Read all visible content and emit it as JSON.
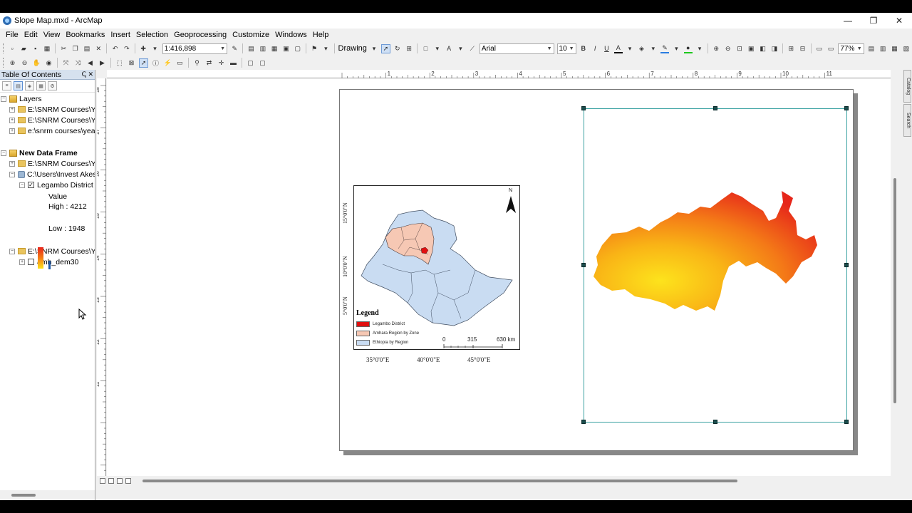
{
  "window": {
    "title": "Slope Map.mxd - ArcMap",
    "controls": [
      "—",
      "❐",
      "✕"
    ]
  },
  "menu": [
    "File",
    "Edit",
    "View",
    "Bookmarks",
    "Insert",
    "Selection",
    "Geoprocessing",
    "Customize",
    "Windows",
    "Help"
  ],
  "toolbar": {
    "scale": "1:416,898",
    "drawing_label": "Drawing",
    "font_name": "Arial",
    "font_size": "10",
    "bold": "B",
    "italic": "I",
    "underline": "U",
    "text_tool": "A",
    "zoom_percent": "77%"
  },
  "toc": {
    "title": "Table Of Contents",
    "header_buttons": "ↅ ✕",
    "layers_group": "Layers",
    "layers_items": [
      "E:\\SNRM Courses\\Yea",
      "E:\\SNRM Courses\\Yea",
      "e:\\snrm courses\\year"
    ],
    "data_frame": "New Data Frame",
    "df_item_1": "E:\\SNRM Courses\\Yea",
    "df_item_2": "C:\\Users\\Invest Akest",
    "layer_name": "Legambo District",
    "value_label": "Value",
    "high_label": "High : 4212",
    "low_label": "Low : 1948",
    "df_item_3": "E:\\SNRM Courses\\Yea",
    "dem_layer": "amh_dem30"
  },
  "ruler": {
    "top_labels": [
      "1",
      "2",
      "3",
      "4",
      "5",
      "6",
      "7",
      "8",
      "9",
      "10",
      "11"
    ],
    "left_labels": [
      "18",
      "17",
      "16",
      "15",
      "14",
      "13",
      "12",
      "11"
    ]
  },
  "inset_map": {
    "north": "N",
    "lat_labels": [
      "15°0'0\"N",
      "10°0'0\"N",
      "5°0'0\"N"
    ],
    "lon_labels": [
      "35°0'0\"E",
      "40°0'0\"E",
      "45°0'0\"E"
    ],
    "legend_title": "Legend",
    "legend_items": [
      {
        "label": "Legambo District",
        "color": "#e01010"
      },
      {
        "label": "Amhara Region by Zone",
        "color": "#f6c8b4"
      },
      {
        "label": "Ethiopia by Region",
        "color": "#c9dcf2"
      }
    ],
    "scale_labels": [
      "0",
      "315",
      "630 km"
    ]
  },
  "colors": {
    "selection_frame": "#3aa2a2",
    "dem_high": "#e8231a",
    "dem_low": "#fde31c",
    "toc_header": "#d6e1ee"
  }
}
